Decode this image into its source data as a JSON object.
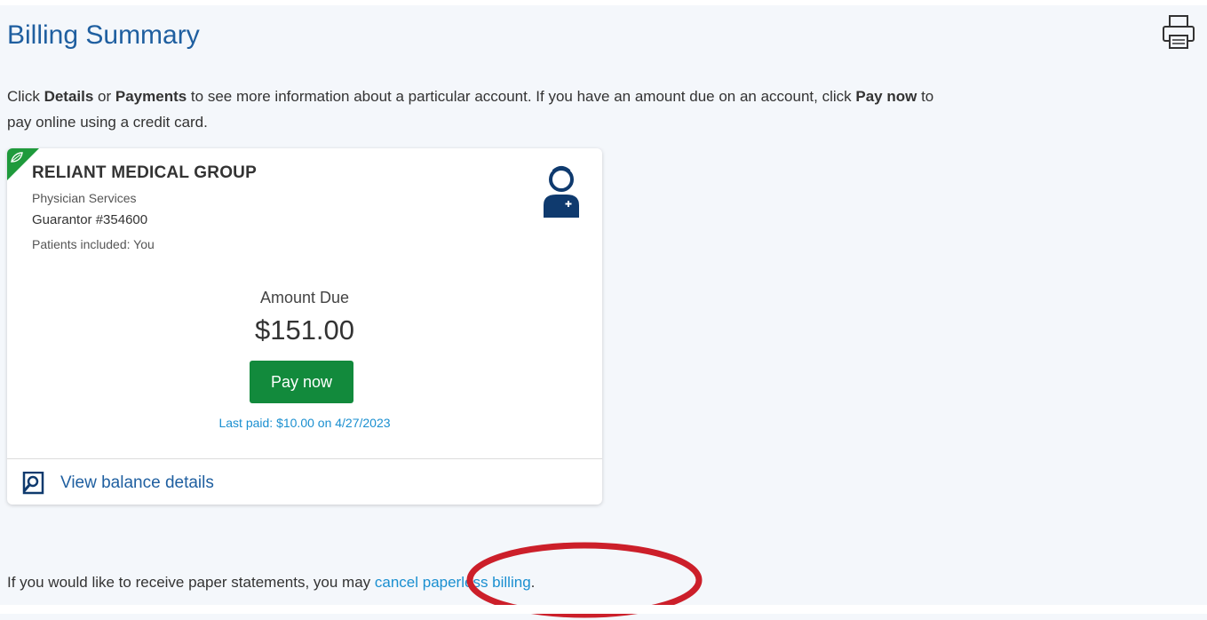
{
  "page": {
    "title": "Billing Summary",
    "intro": {
      "part1": "Click ",
      "details": "Details",
      "part2": " or ",
      "payments": "Payments",
      "part3": " to see more information about a particular account. If you have an amount due on an account, click ",
      "pay_now": "Pay now",
      "part4": " to",
      "line2": "pay online using a credit card."
    }
  },
  "account_card": {
    "organization": "RELIANT MEDICAL GROUP",
    "service_type": "Physician Services",
    "guarantor": "Guarantor #354600",
    "patients_included": "Patients included: You",
    "amount_due_label": "Amount Due",
    "amount_due_value": "$151.00",
    "pay_button_label": "Pay now",
    "last_paid": "Last paid: $10.00 on 4/27/2023",
    "view_details_label": "View balance details"
  },
  "paper_statements": {
    "text": "If you would like to receive paper statements, you may ",
    "link_label": "cancel paperless billing",
    "suffix": "."
  },
  "icons": {
    "print": "printer-icon",
    "leaf": "leaf-icon",
    "doctor": "doctor-icon",
    "details": "magnifier-icon"
  },
  "colors": {
    "title": "#1f5fa0",
    "pay_button": "#128a3c",
    "link": "#1a8fd0",
    "leaf_badge": "#1f9a3c",
    "doctor_icon": "#0f3a6e",
    "highlight": "#cc1f2a"
  }
}
